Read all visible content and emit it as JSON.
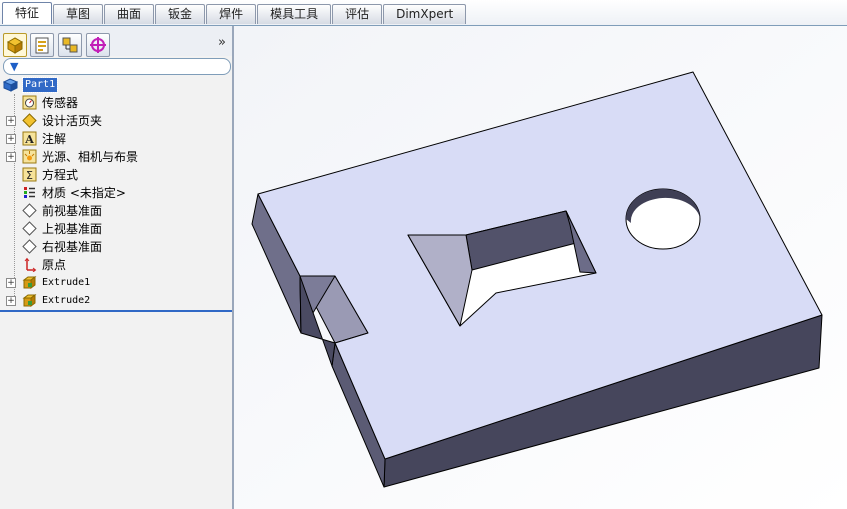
{
  "tabs": [
    "特征",
    "草图",
    "曲面",
    "钣金",
    "焊件",
    "模具工具",
    "评估",
    "DimXpert"
  ],
  "active_tab": "特征",
  "panel": {
    "toolbar_icons": [
      "feature-manager-icon",
      "property-manager-icon",
      "configuration-manager-icon",
      "dimxpert-manager-icon"
    ],
    "more_glyph": "»",
    "filter_icon": "filter-icon"
  },
  "tree": {
    "root": {
      "label": "Part1",
      "icon": "part-icon"
    },
    "items": [
      {
        "label": "传感器",
        "icon": "sensor-icon",
        "expandable": false
      },
      {
        "label": "设计活页夹",
        "icon": "design-binder-icon",
        "expandable": true
      },
      {
        "label": "注解",
        "icon": "annotations-icon",
        "expandable": true
      },
      {
        "label": "光源、相机与布景",
        "icon": "lights-cameras-icon",
        "expandable": true
      },
      {
        "label": "方程式",
        "icon": "equations-icon",
        "expandable": false
      },
      {
        "label": "材质 <未指定>",
        "icon": "material-icon",
        "expandable": false
      },
      {
        "label": "前视基准面",
        "icon": "plane-icon",
        "expandable": false
      },
      {
        "label": "上视基准面",
        "icon": "plane-icon",
        "expandable": false
      },
      {
        "label": "右视基准面",
        "icon": "plane-icon",
        "expandable": false
      },
      {
        "label": "原点",
        "icon": "origin-icon",
        "expandable": false
      },
      {
        "label": "Extrude1",
        "icon": "extrude-icon",
        "expandable": true
      },
      {
        "label": "Extrude2",
        "icon": "extrude-icon",
        "expandable": true
      }
    ]
  },
  "colors": {
    "top_face": "#d8dcf6",
    "side_dark": "#46465c",
    "side_mid": "#8c8ca8",
    "edge": "#000000",
    "selection": "#3169c6"
  }
}
